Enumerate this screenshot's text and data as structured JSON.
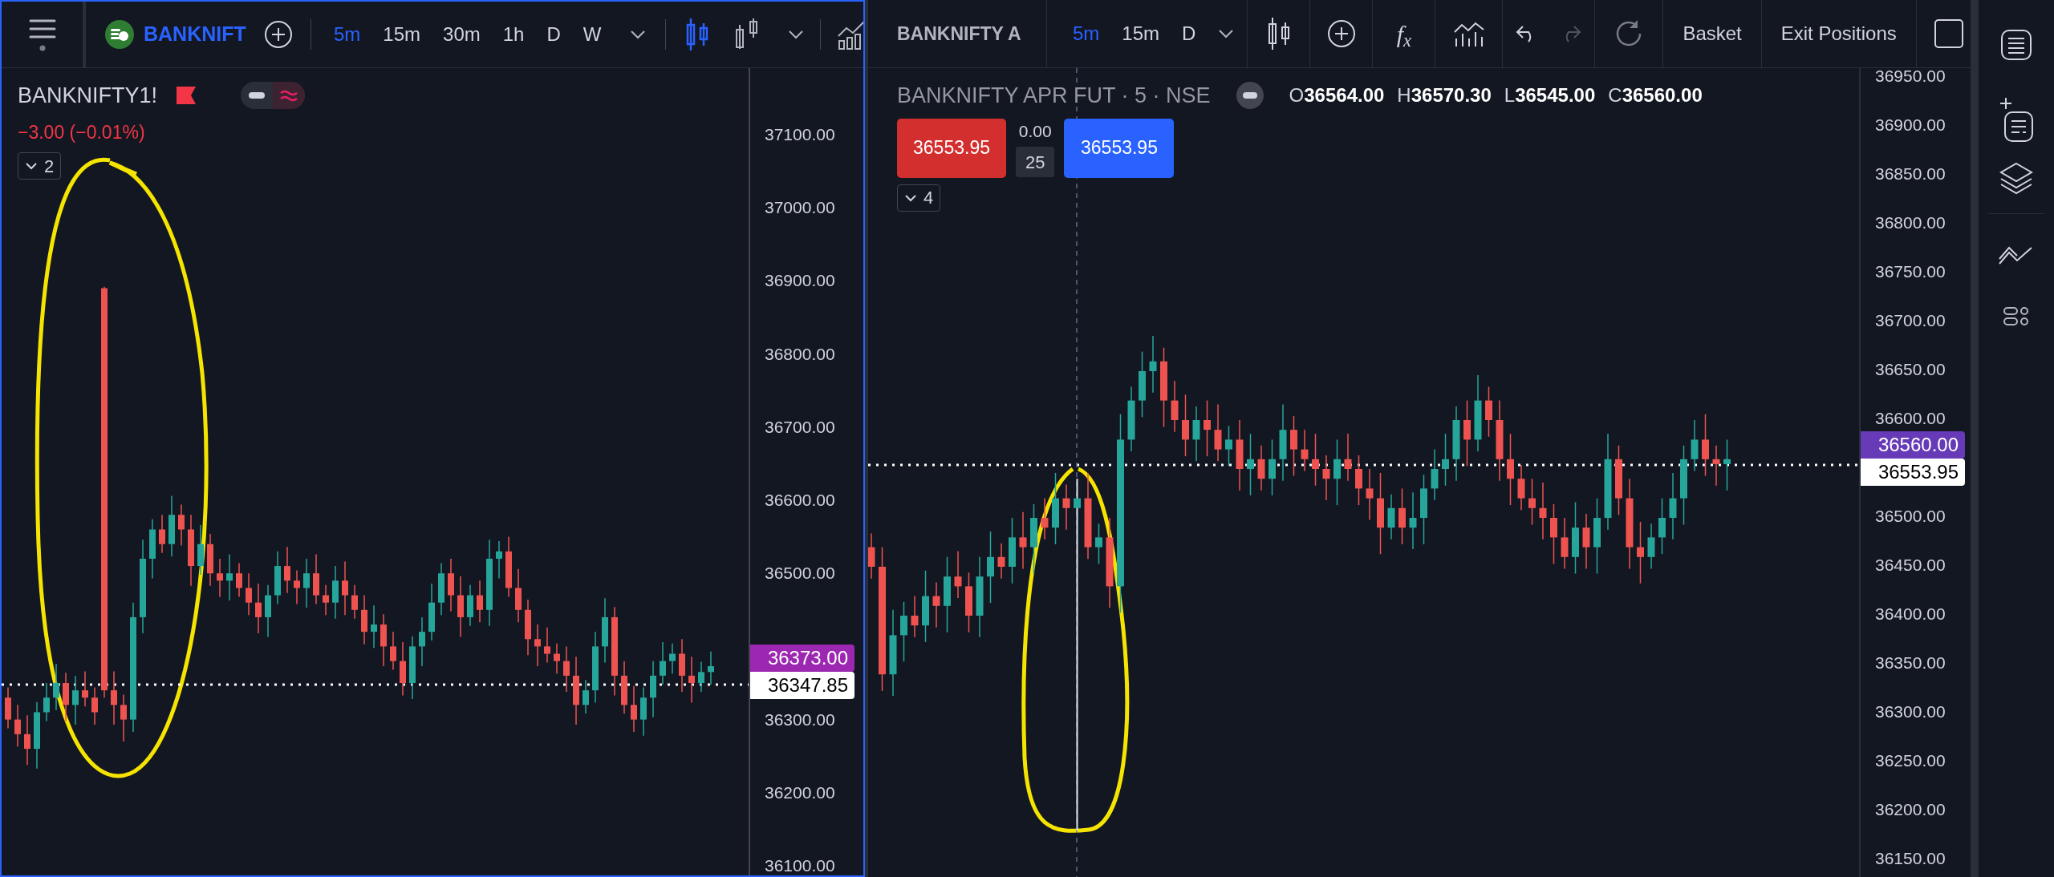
{
  "left_chart": {
    "toolbar": {
      "symbol": "BANKNIFT",
      "intervals": [
        {
          "label": "5m",
          "selected": true
        },
        {
          "label": "15m",
          "selected": false
        },
        {
          "label": "30m",
          "selected": false
        },
        {
          "label": "1h",
          "selected": false
        },
        {
          "label": "D",
          "selected": false
        },
        {
          "label": "W",
          "selected": false
        }
      ]
    },
    "legend": {
      "symbol": "BANKNIFTY1!",
      "change": "−3.00 (−0.01%)",
      "indicators_count": "2"
    },
    "price_scale": [
      "37100.00",
      "37000.00",
      "36900.00",
      "36800.00",
      "36700.00",
      "36600.00",
      "36500.00",
      "36300.00",
      "36200.00",
      "36100.00"
    ],
    "last_price": "36373.00",
    "current_price": "36347.85"
  },
  "right_chart": {
    "toolbar": {
      "symbol": "BANKNIFTY A",
      "intervals": [
        {
          "label": "5m",
          "selected": true
        },
        {
          "label": "15m",
          "selected": false
        },
        {
          "label": "D",
          "selected": false
        }
      ],
      "functions_button": "f$_{x}$",
      "history_buttons": [
        {
          "kind": "undo",
          "disabled": false
        },
        {
          "kind": "redo",
          "disabled": true
        }
      ],
      "buttons": [
        "Basket",
        "Exit Positions"
      ]
    },
    "legend": {
      "title": "BANKNIFTY APR FUT · 5 · NSE",
      "ohlc": [
        {
          "label": "O",
          "value": "36564.00"
        },
        {
          "label": "H",
          "value": "36570.30"
        },
        {
          "label": "L",
          "value": "36545.00"
        },
        {
          "label": "C",
          "value": "36560.00"
        }
      ]
    },
    "order_panel": {
      "sell_price": "36553.95",
      "spread": "0.00",
      "quantity": "25",
      "buy_price": "36553.95"
    },
    "indicators_count": "4",
    "price_scale": [
      "36950.00",
      "36900.00",
      "36850.00",
      "36800.00",
      "36750.00",
      "36700.00",
      "36650.00",
      "36600.00",
      "36500.00",
      "36450.00",
      "36400.00",
      "36350.00",
      "36300.00",
      "36250.00",
      "36200.00",
      "36150.00"
    ],
    "last_price": "36560.00",
    "current_price": "36553.95"
  }
}
